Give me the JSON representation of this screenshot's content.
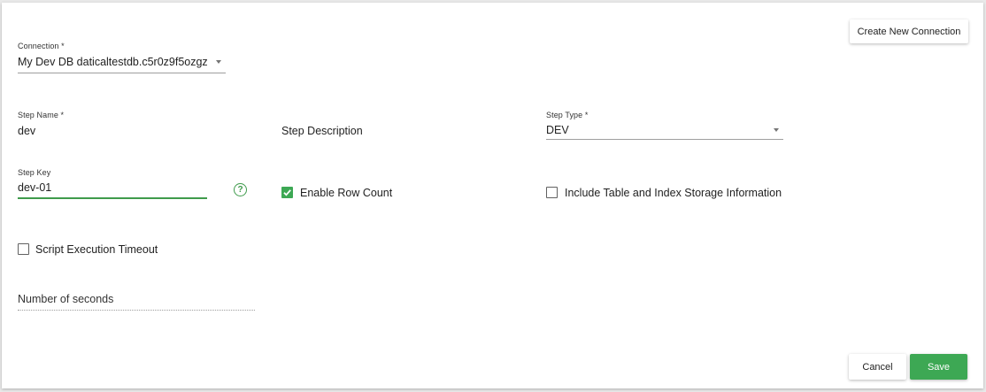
{
  "connection": {
    "label": "Connection *",
    "value": "My Dev DB daticaltestdb.c5r0z9f5ozgz...."
  },
  "create_connection_label": "Create New Connection",
  "step_name": {
    "label": "Step Name *",
    "value": "dev"
  },
  "step_description": {
    "placeholder": "Step Description"
  },
  "step_type": {
    "label": "Step Type *",
    "value": "DEV"
  },
  "step_key": {
    "label": "Step Key",
    "value": "dev-01",
    "help_icon": "help-circle-icon"
  },
  "enable_row_count": {
    "label": "Enable Row Count",
    "checked": true
  },
  "include_storage_info": {
    "label": "Include Table and Index Storage Information",
    "checked": false
  },
  "script_timeout": {
    "label": "Script Execution Timeout",
    "checked": false
  },
  "number_of_seconds": {
    "placeholder": "Number of seconds"
  },
  "actions": {
    "cancel_label": "Cancel",
    "save_label": "Save"
  },
  "colors": {
    "accent": "#3da854",
    "field_focus": "#3f9b4c",
    "underline": "#9e9e9e"
  }
}
